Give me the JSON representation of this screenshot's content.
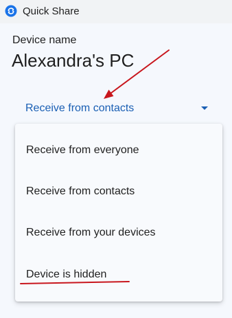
{
  "window": {
    "title": "Quick Share",
    "icon": "quick-share-icon"
  },
  "device": {
    "label": "Device name",
    "name": "Alexandra's PC"
  },
  "receive_selector": {
    "selected": "Receive from contacts",
    "icon": "chevron-down-icon"
  },
  "menu": {
    "items": [
      {
        "label": "Receive from everyone"
      },
      {
        "label": "Receive from contacts"
      },
      {
        "label": "Receive from your devices"
      },
      {
        "label": "Device is hidden"
      }
    ]
  },
  "colors": {
    "accent": "#1a5fb4",
    "annotation": "#c8161d"
  }
}
